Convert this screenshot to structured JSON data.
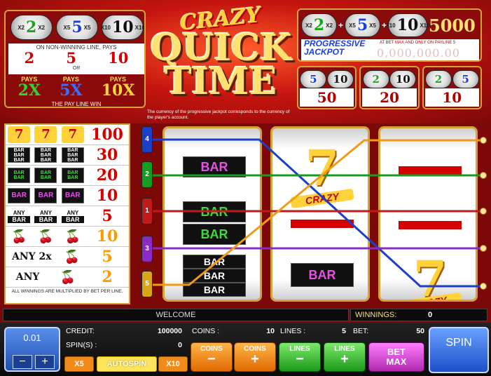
{
  "multiplier_panel": {
    "badges": [
      {
        "left": "X2",
        "value": "2",
        "right": "X2"
      },
      {
        "left": "X5",
        "value": "5",
        "right": "X5"
      },
      {
        "left": "X10",
        "value": "10",
        "right": "X10"
      }
    ],
    "caption": "ON NON-WINNING LINE, PAYS",
    "values": [
      "2",
      "5",
      "10"
    ],
    "or_text": "OR",
    "pays": [
      {
        "label": "PAYS",
        "value": "2X"
      },
      {
        "label": "PAYS",
        "value": "5X"
      },
      {
        "label": "PAYS",
        "value": "10X"
      }
    ],
    "footer": "THE PAY LINE WIN"
  },
  "logo": {
    "crazy": "CRAZY",
    "quick": "QUICK",
    "time": "TIME"
  },
  "currency_note": "The currency of the progressive jackpot corresponds to the currency of the player's account.",
  "jackpot": {
    "badges": [
      {
        "left": "X2",
        "value": "2",
        "right": "X2"
      },
      {
        "left": "X5",
        "value": "5",
        "right": "X5"
      },
      {
        "left": "X10",
        "value": "10",
        "right": "X10"
      }
    ],
    "plus": "+",
    "amount": "5000",
    "label_line1": "PROGRESSIVE",
    "label_line2": "JACKPOT",
    "note": "AT BET MAX AND ONLY ON PAYLINE 5",
    "value": "0,000,000.00"
  },
  "combos": [
    {
      "badges": [
        "5",
        "10"
      ],
      "value": "50"
    },
    {
      "badges": [
        "2",
        "10"
      ],
      "value": "20"
    },
    {
      "badges": [
        "2",
        "5"
      ],
      "value": "10"
    }
  ],
  "paytable": {
    "rows": [
      {
        "type": "seven",
        "label": "CRAZY",
        "pay": "100"
      },
      {
        "type": "bar-white",
        "label": "BAR",
        "pay": "30"
      },
      {
        "type": "bar-green",
        "label": "BAR",
        "pay": "20"
      },
      {
        "type": "bar-purple",
        "label": "BAR",
        "pay": "10"
      },
      {
        "type": "anybar",
        "any": "ANY",
        "label": "BAR",
        "pay": "5"
      },
      {
        "type": "cherry",
        "pay": "10"
      },
      {
        "type": "any2x",
        "text": "ANY 2x",
        "pay": "5"
      },
      {
        "type": "any1",
        "text": "ANY",
        "pay": "2"
      }
    ],
    "footer": "ALL WINNINGS ARE MULTIPLIED BY BET PER LINE."
  },
  "line_buttons": [
    "4",
    "2",
    "1",
    "3",
    "5"
  ],
  "reels": {
    "bar_label": "BAR",
    "seven_label": "CRAZY"
  },
  "status": {
    "message": "WELCOME",
    "winnings_label": "WINNINGS:",
    "winnings_value": "0"
  },
  "bet": {
    "value": "0.01",
    "minus": "−",
    "plus": "+"
  },
  "info": {
    "credit_label": "CREDIT:",
    "credit_value": "100000",
    "spins_label": "SPIN(S) :",
    "spins_value": "0",
    "coins_label": "COINS :",
    "coins_value": "10",
    "lines_label": "LINES :",
    "lines_value": "5",
    "bet_label": "BET:",
    "bet_value": "50"
  },
  "buttons": {
    "x5": "X5",
    "autospin": "AUTOSPIN",
    "x10": "X10",
    "coins": "COINS",
    "lines": "LINES",
    "minus": "−",
    "plus": "+",
    "bet_max_1": "BET",
    "bet_max_2": "MAX",
    "spin": "SPIN"
  },
  "colors": {
    "line1": "#c11a1a",
    "line2": "#179b21",
    "line3": "#8a2bc4",
    "line4": "#1c3ec8",
    "line5": "#f09a1a"
  }
}
